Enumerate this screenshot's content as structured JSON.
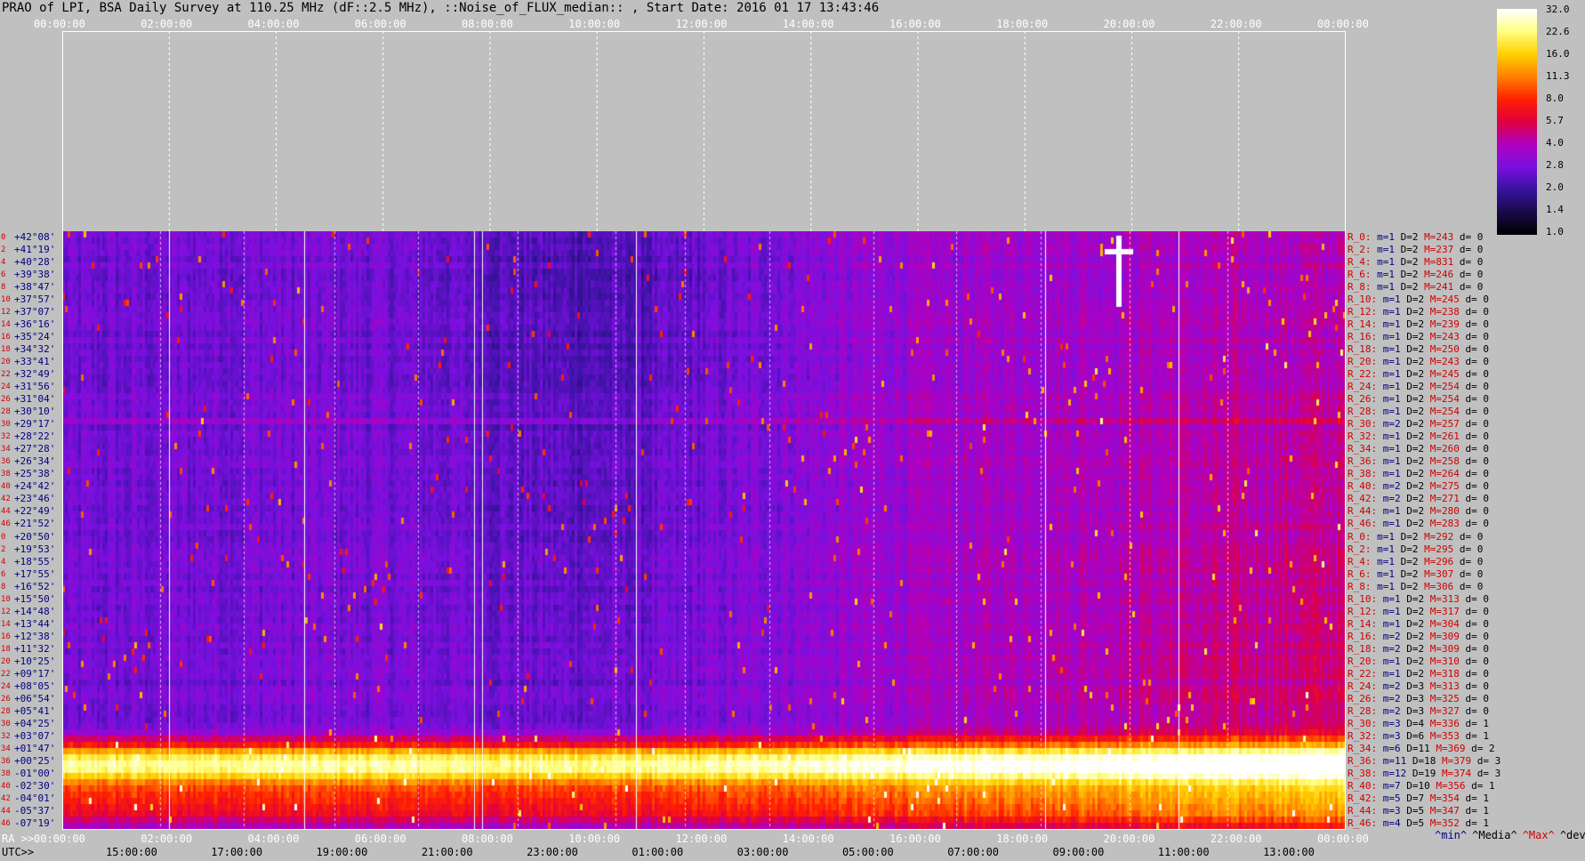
{
  "title": "PRAO of LPI, BSA Daily Survey at 110.25 MHz (dF::2.5 MHz), ::Noise_of_FLUX_median:: , Start Date: 2016 01 17 13:43:46",
  "axis_labels": {
    "ra": "RA >>",
    "utc": "UTC>>"
  },
  "stat_legend": [
    {
      "text": "^min^",
      "color": "#000080"
    },
    {
      "text": "^Media^",
      "color": "#000000"
    },
    {
      "text": "^Max^",
      "color": "#d00000"
    },
    {
      "text": "^devia^",
      "color": "#000000"
    }
  ],
  "chart_data": {
    "type": "heatmap",
    "title": "PRAO of LPI, BSA Daily Survey at 110.25 MHz (dF::2.5 MHz), ::Noise_of_FLUX_median:: , Start Date: 2016 01 17 13:43:46",
    "x_top_ticks": [
      "00:00:00",
      "02:00:00",
      "04:00:00",
      "06:00:00",
      "08:00:00",
      "10:00:00",
      "12:00:00",
      "14:00:00",
      "16:00:00",
      "18:00:00",
      "20:00:00",
      "22:00:00",
      "00:00:00"
    ],
    "ra_ticks": [
      "00:00:00",
      "02:00:00",
      "04:00:00",
      "06:00:00",
      "08:00:00",
      "10:00:00",
      "12:00:00",
      "14:00:00",
      "16:00:00",
      "18:00:00",
      "20:00:00",
      "22:00:00",
      "00:00:00"
    ],
    "utc_ticks": [
      "15:00:00",
      "17:00:00",
      "19:00:00",
      "21:00:00",
      "23:00:00",
      "01:00:00",
      "03:00:00",
      "05:00:00",
      "07:00:00",
      "09:00:00",
      "11:00:00",
      "13:00:00"
    ],
    "colorbar": {
      "ticks": [
        "32.0",
        "22.6",
        "16.0",
        "11.3",
        "8.0",
        "5.7",
        "4.0",
        "2.8",
        "2.0",
        "1.4",
        "1.0"
      ],
      "range": [
        1.0,
        32.0
      ],
      "scale": "log",
      "colormap": [
        "#000000",
        "#1a0a4a",
        "#3a12a0",
        "#7a10e0",
        "#b000c0",
        "#e00040",
        "#ff2000",
        "#ff8000",
        "#ffd000",
        "#ffff80",
        "#ffffff"
      ]
    },
    "declinations": [
      "+42°08'",
      "+41°19'",
      "+40°28'",
      "+39°38'",
      "+38°47'",
      "+37°57'",
      "+37°07'",
      "+36°16'",
      "+35°24'",
      "+34°32'",
      "+33°41'",
      "+32°49'",
      "+31°56'",
      "+31°04'",
      "+30°10'",
      "+29°17'",
      "+28°22'",
      "+27°28'",
      "+26°34'",
      "+25°38'",
      "+24°42'",
      "+23°46'",
      "+22°49'",
      "+21°52'",
      "+20°50'",
      "+19°53'",
      "+18°55'",
      "+17°55'",
      "+16°52'",
      "+15°50'",
      "+14°48'",
      "+13°44'",
      "+12°38'",
      "+11°32'",
      "+10°25'",
      "+09°17'",
      "+08°05'",
      "+06°54'",
      "+05°41'",
      "+04°25'",
      "+03°07'",
      "+01°47'",
      "+00°25'",
      "-01°00'",
      "-02°30'",
      "-04°01'",
      "-05°37'",
      "-07°19'"
    ],
    "row_indices": [
      "0",
      "2",
      "4",
      "6",
      "8",
      "10",
      "12",
      "14",
      "16",
      "18",
      "20",
      "22",
      "24",
      "26",
      "28",
      "30",
      "32",
      "34",
      "36",
      "38",
      "40",
      "42",
      "44",
      "46",
      "0",
      "2",
      "4",
      "6",
      "8",
      "10",
      "12",
      "14",
      "16",
      "18",
      "20",
      "22",
      "24",
      "26",
      "28",
      "30",
      "32",
      "34",
      "36",
      "38",
      "40",
      "42",
      "44",
      "46"
    ],
    "row_stats": [
      {
        "r": "R_0:",
        "m": "m=1",
        "D": "D=2",
        "M": "M=243",
        "d": "d= 0"
      },
      {
        "r": "R_2:",
        "m": "m=1",
        "D": "D=2",
        "M": "M=237",
        "d": "d= 0"
      },
      {
        "r": "R_4:",
        "m": "m=1",
        "D": "D=2",
        "M": "M=831",
        "d": "d= 0"
      },
      {
        "r": "R_6:",
        "m": "m=1",
        "D": "D=2",
        "M": "M=246",
        "d": "d= 0"
      },
      {
        "r": "R_8:",
        "m": "m=1",
        "D": "D=2",
        "M": "M=241",
        "d": "d= 0"
      },
      {
        "r": "R_10:",
        "m": "m=1",
        "D": "D=2",
        "M": "M=245",
        "d": "d= 0"
      },
      {
        "r": "R_12:",
        "m": "m=1",
        "D": "D=2",
        "M": "M=238",
        "d": "d= 0"
      },
      {
        "r": "R_14:",
        "m": "m=1",
        "D": "D=2",
        "M": "M=239",
        "d": "d= 0"
      },
      {
        "r": "R_16:",
        "m": "m=1",
        "D": "D=2",
        "M": "M=243",
        "d": "d= 0"
      },
      {
        "r": "R_18:",
        "m": "m=1",
        "D": "D=2",
        "M": "M=250",
        "d": "d= 0"
      },
      {
        "r": "R_20:",
        "m": "m=1",
        "D": "D=2",
        "M": "M=243",
        "d": "d= 0"
      },
      {
        "r": "R_22:",
        "m": "m=1",
        "D": "D=2",
        "M": "M=245",
        "d": "d= 0"
      },
      {
        "r": "R_24:",
        "m": "m=1",
        "D": "D=2",
        "M": "M=254",
        "d": "d= 0"
      },
      {
        "r": "R_26:",
        "m": "m=1",
        "D": "D=2",
        "M": "M=254",
        "d": "d= 0"
      },
      {
        "r": "R_28:",
        "m": "m=1",
        "D": "D=2",
        "M": "M=254",
        "d": "d= 0"
      },
      {
        "r": "R_30:",
        "m": "m=2",
        "D": "D=2",
        "M": "M=257",
        "d": "d= 0"
      },
      {
        "r": "R_32:",
        "m": "m=1",
        "D": "D=2",
        "M": "M=261",
        "d": "d= 0"
      },
      {
        "r": "R_34:",
        "m": "m=1",
        "D": "D=2",
        "M": "M=260",
        "d": "d= 0"
      },
      {
        "r": "R_36:",
        "m": "m=1",
        "D": "D=2",
        "M": "M=258",
        "d": "d= 0"
      },
      {
        "r": "R_38:",
        "m": "m=1",
        "D": "D=2",
        "M": "M=264",
        "d": "d= 0"
      },
      {
        "r": "R_40:",
        "m": "m=2",
        "D": "D=2",
        "M": "M=275",
        "d": "d= 0"
      },
      {
        "r": "R_42:",
        "m": "m=2",
        "D": "D=2",
        "M": "M=271",
        "d": "d= 0"
      },
      {
        "r": "R_44:",
        "m": "m=1",
        "D": "D=2",
        "M": "M=280",
        "d": "d= 0"
      },
      {
        "r": "R_46:",
        "m": "m=1",
        "D": "D=2",
        "M": "M=283",
        "d": "d= 0"
      },
      {
        "r": "R_0:",
        "m": "m=1",
        "D": "D=2",
        "M": "M=292",
        "d": "d= 0"
      },
      {
        "r": "R_2:",
        "m": "m=1",
        "D": "D=2",
        "M": "M=295",
        "d": "d= 0"
      },
      {
        "r": "R_4:",
        "m": "m=1",
        "D": "D=2",
        "M": "M=296",
        "d": "d= 0"
      },
      {
        "r": "R_6:",
        "m": "m=1",
        "D": "D=2",
        "M": "M=307",
        "d": "d= 0"
      },
      {
        "r": "R_8:",
        "m": "m=1",
        "D": "D=2",
        "M": "M=306",
        "d": "d= 0"
      },
      {
        "r": "R_10:",
        "m": "m=1",
        "D": "D=2",
        "M": "M=313",
        "d": "d= 0"
      },
      {
        "r": "R_12:",
        "m": "m=1",
        "D": "D=2",
        "M": "M=317",
        "d": "d= 0"
      },
      {
        "r": "R_14:",
        "m": "m=1",
        "D": "D=2",
        "M": "M=304",
        "d": "d= 0"
      },
      {
        "r": "R_16:",
        "m": "m=2",
        "D": "D=2",
        "M": "M=309",
        "d": "d= 0"
      },
      {
        "r": "R_18:",
        "m": "m=2",
        "D": "D=2",
        "M": "M=309",
        "d": "d= 0"
      },
      {
        "r": "R_20:",
        "m": "m=1",
        "D": "D=2",
        "M": "M=310",
        "d": "d= 0"
      },
      {
        "r": "R_22:",
        "m": "m=1",
        "D": "D=2",
        "M": "M=318",
        "d": "d= 0"
      },
      {
        "r": "R_24:",
        "m": "m=2",
        "D": "D=3",
        "M": "M=313",
        "d": "d= 0"
      },
      {
        "r": "R_26:",
        "m": "m=2",
        "D": "D=3",
        "M": "M=325",
        "d": "d= 0"
      },
      {
        "r": "R_28:",
        "m": "m=2",
        "D": "D=3",
        "M": "M=327",
        "d": "d= 0"
      },
      {
        "r": "R_30:",
        "m": "m=3",
        "D": "D=4",
        "M": "M=336",
        "d": "d= 1"
      },
      {
        "r": "R_32:",
        "m": "m=3",
        "D": "D=6",
        "M": "M=353",
        "d": "d= 1"
      },
      {
        "r": "R_34:",
        "m": "m=6",
        "D": "D=11",
        "M": "M=369",
        "d": "d= 2"
      },
      {
        "r": "R_36:",
        "m": "m=11",
        "D": "D=18",
        "M": "M=379",
        "d": "d= 3"
      },
      {
        "r": "R_38:",
        "m": "m=12",
        "D": "D=19",
        "M": "M=374",
        "d": "d= 3"
      },
      {
        "r": "R_40:",
        "m": "m=7",
        "D": "D=10",
        "M": "M=356",
        "d": "d= 1"
      },
      {
        "r": "R_42:",
        "m": "m=5",
        "D": "D=7",
        "M": "M=354",
        "d": "d= 1"
      },
      {
        "r": "R_44:",
        "m": "m=3",
        "D": "D=5",
        "M": "M=347",
        "d": "d= 1"
      },
      {
        "r": "R_46:",
        "m": "m=4",
        "D": "D=5",
        "M": "M=352",
        "d": "d= 1"
      }
    ]
  }
}
